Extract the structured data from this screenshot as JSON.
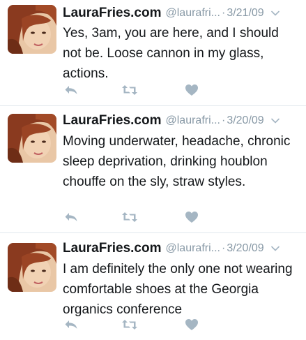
{
  "colors": {
    "name": "#14171a",
    "meta": "#8899a6",
    "icon": "#a5b6c3",
    "divider": "#e1e8ed"
  },
  "tweets": [
    {
      "name": "LauraFries.com",
      "handle": "@laurafri...",
      "separator": "·",
      "date": "3/21/09",
      "text": "Yes, 3am, you are here, and I should not be. Loose cannon in my glass, actions.",
      "icons": [
        "reply-icon",
        "retweet-icon",
        "like-icon",
        "chevron-down-icon"
      ]
    },
    {
      "name": "LauraFries.com",
      "handle": "@laurafri...",
      "separator": "·",
      "date": "3/20/09",
      "text": "Moving underwater, headache, chronic sleep deprivation, drinking houblon chouffe on the sly, straw styles.",
      "icons": [
        "reply-icon",
        "retweet-icon",
        "like-icon",
        "chevron-down-icon"
      ]
    },
    {
      "name": "LauraFries.com",
      "handle": "@laurafri...",
      "separator": "·",
      "date": "3/20/09",
      "text": "I am definitely the only one not wearing comfortable shoes at the Georgia organics conference",
      "icons": [
        "reply-icon",
        "retweet-icon",
        "like-icon",
        "chevron-down-icon"
      ]
    }
  ]
}
